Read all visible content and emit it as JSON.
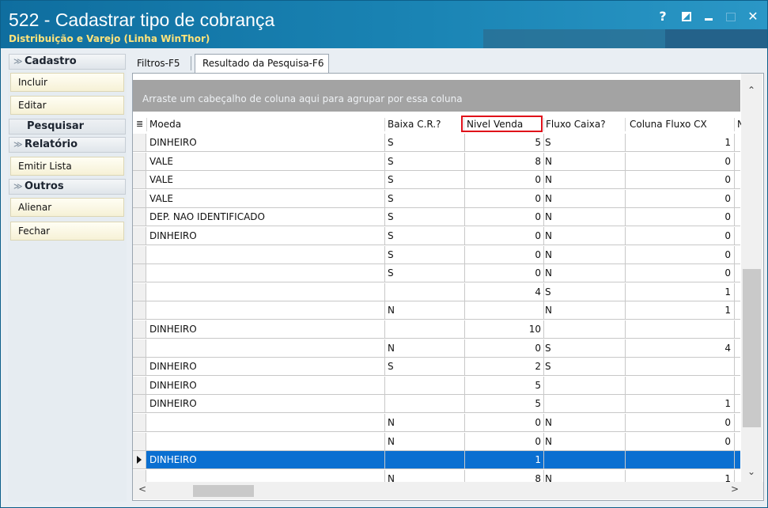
{
  "window": {
    "title": "522 - Cadastrar tipo de cobrança",
    "subtitle": "Distribuição e Varejo (Linha WinThor)",
    "buttons": {
      "help": "?",
      "close": "✕"
    }
  },
  "sidebar": {
    "cadastro_label": "Cadastro",
    "incluir": "Incluir",
    "editar": "Editar",
    "pesquisar_label": "Pesquisar",
    "relatorio_label": "Relatório",
    "emitir_lista": "Emitir Lista",
    "outros_label": "Outros",
    "alienar": "Alienar",
    "fechar": "Fechar"
  },
  "tabs": {
    "filtros": "Filtros-F5",
    "resultado": "Resultado da Pesquisa-F6"
  },
  "grid": {
    "group_hint": "Arraste um cabeçalho de coluna aqui para agrupar por essa coluna",
    "columns": {
      "moeda": "Moeda",
      "baixa": "Baixa C.R.?",
      "nivel": "Nivel Venda",
      "fluxo": "Fluxo Caixa?",
      "coluna_fluxo": "Coluna Fluxo CX",
      "next": "N"
    },
    "rows": [
      {
        "moeda": "DINHEIRO",
        "baixa": "S",
        "nivel": "5",
        "fluxo": "S",
        "coluna": "1"
      },
      {
        "moeda": "VALE",
        "baixa": "S",
        "nivel": "8",
        "fluxo": "N",
        "coluna": "0"
      },
      {
        "moeda": "VALE",
        "baixa": "S",
        "nivel": "0",
        "fluxo": "N",
        "coluna": "0"
      },
      {
        "moeda": "VALE",
        "baixa": "S",
        "nivel": "0",
        "fluxo": "N",
        "coluna": "0"
      },
      {
        "moeda": "DEP. NAO IDENTIFICADO",
        "baixa": "S",
        "nivel": "0",
        "fluxo": "N",
        "coluna": "0"
      },
      {
        "moeda": "DINHEIRO",
        "baixa": "S",
        "nivel": "0",
        "fluxo": "N",
        "coluna": "0"
      },
      {
        "moeda": "",
        "baixa": "S",
        "nivel": "0",
        "fluxo": "N",
        "coluna": "0"
      },
      {
        "moeda": "",
        "baixa": "S",
        "nivel": "0",
        "fluxo": "N",
        "coluna": "0"
      },
      {
        "moeda": "",
        "baixa": "",
        "nivel": "4",
        "fluxo": "S",
        "coluna": "1"
      },
      {
        "moeda": "",
        "baixa": "N",
        "nivel": "",
        "fluxo": "N",
        "coluna": "1"
      },
      {
        "moeda": "DINHEIRO",
        "baixa": "",
        "nivel": "10",
        "fluxo": "",
        "coluna": ""
      },
      {
        "moeda": "",
        "baixa": "N",
        "nivel": "0",
        "fluxo": "S",
        "coluna": "4"
      },
      {
        "moeda": "DINHEIRO",
        "baixa": "S",
        "nivel": "2",
        "fluxo": "S",
        "coluna": ""
      },
      {
        "moeda": "DINHEIRO",
        "baixa": "",
        "nivel": "5",
        "fluxo": "",
        "coluna": ""
      },
      {
        "moeda": "DINHEIRO",
        "baixa": "",
        "nivel": "5",
        "fluxo": "",
        "coluna": "1"
      },
      {
        "moeda": "",
        "baixa": "N",
        "nivel": "0",
        "fluxo": "N",
        "coluna": "0"
      },
      {
        "moeda": "",
        "baixa": "N",
        "nivel": "0",
        "fluxo": "N",
        "coluna": "0"
      },
      {
        "moeda": "DINHEIRO",
        "baixa": "",
        "nivel": "1",
        "fluxo": "",
        "coluna": "",
        "selected": true
      },
      {
        "moeda": "",
        "baixa": "N",
        "nivel": "8",
        "fluxo": "N",
        "coluna": "1"
      }
    ]
  }
}
